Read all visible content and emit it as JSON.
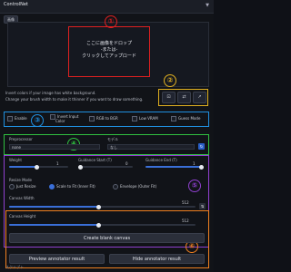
{
  "header": {
    "title": "ControlNet"
  },
  "tab_chip": "画像",
  "drop_area": {
    "line1": "ここに画像をドロップ",
    "line2": "-または-",
    "line3": "クリックしてアップロード"
  },
  "markers": {
    "m1": "①",
    "m2": "②",
    "m3": "③",
    "m4": "④",
    "m5": "⑤",
    "m6": "⑥"
  },
  "info": {
    "line1": "Invert colors if your image has white background.",
    "line2": "Change your brush width to make it thinner if you want to draw something."
  },
  "tool_buttons": [
    "⊡",
    "⇄",
    "↗"
  ],
  "checkboxes": {
    "enable": "Enable",
    "invert_input_line1": "Invert Input",
    "invert_input_line2": "Color",
    "rgb_to_bgr": "RGB to BGR",
    "low_vram": "Low VRAM",
    "guess_mode": "Guess Mode"
  },
  "preprocessor": {
    "label": "Preprocessor",
    "value": "none"
  },
  "model": {
    "label": "モデル",
    "value": "なし"
  },
  "sliders": {
    "weight": {
      "label": "Weight",
      "value": "1"
    },
    "guidance_start": {
      "label": "Guidance Start (T)",
      "value": "0"
    },
    "guidance_end": {
      "label": "Guidance End (T)",
      "value": "1"
    }
  },
  "resize_mode": {
    "label": "Resize Mode",
    "options": [
      "Just Resize",
      "Scale to Fit (Inner Fit)",
      "Envelope (Outer Fit)"
    ],
    "selected": 1
  },
  "canvas": {
    "width_label": "Canvas Width",
    "width_value": "512",
    "height_label": "Canvas Height",
    "height_value": "512"
  },
  "swap_icon": "⇅",
  "buttons": {
    "create_canvas": "Create blank canvas",
    "preview": "Preview annotator result",
    "hide": "Hide annotator result"
  },
  "footer": "スクリプト",
  "colors": {
    "red": "#e02020",
    "yellow": "#e0b020",
    "blue": "#2090e0",
    "green": "#30c040",
    "purple": "#9040d0",
    "orange": "#f08020"
  }
}
